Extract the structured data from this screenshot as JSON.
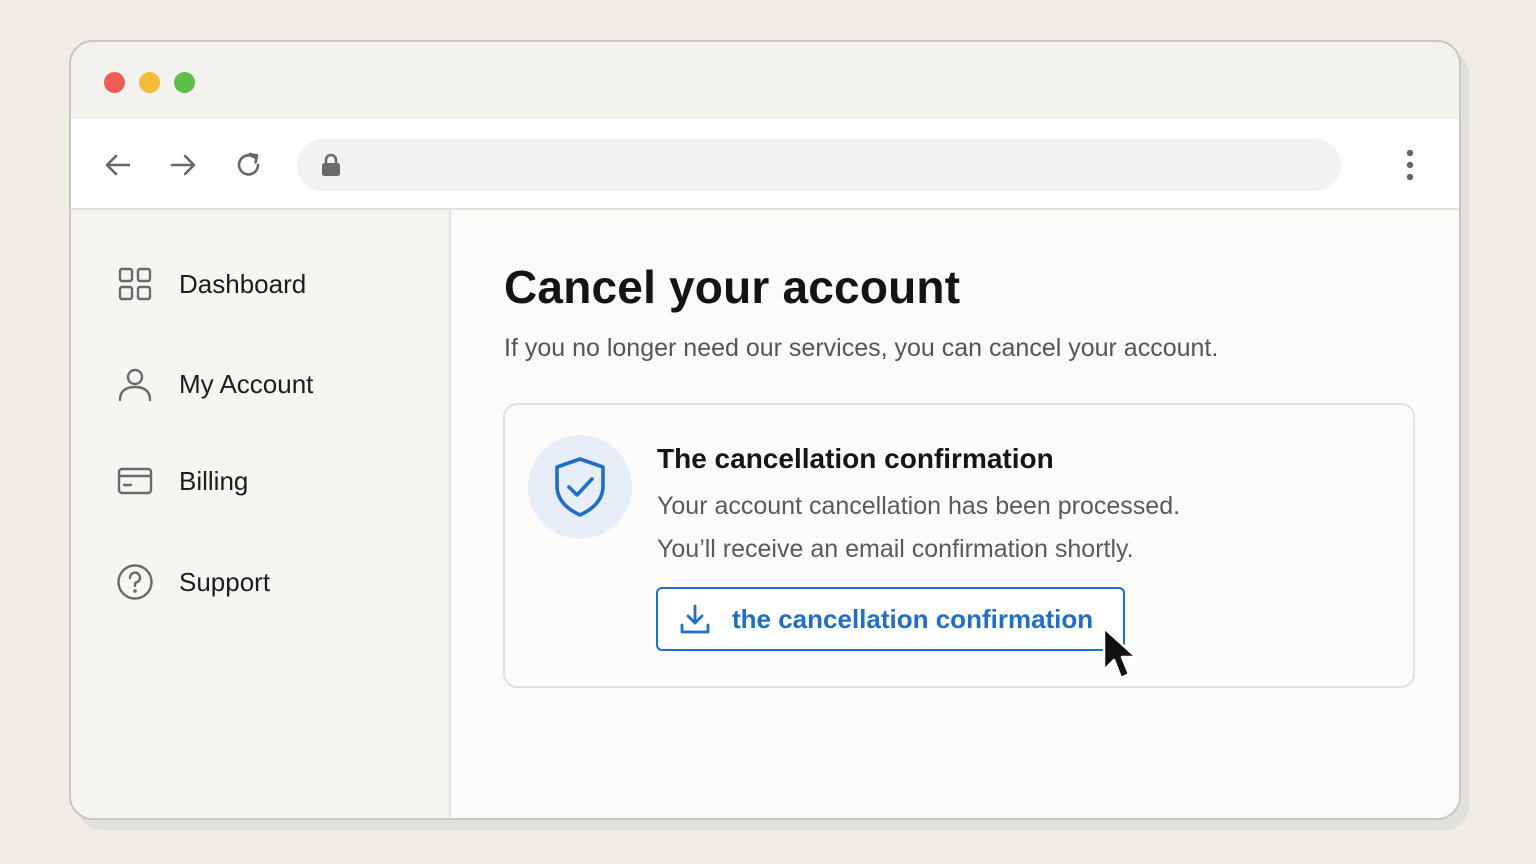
{
  "browser": {
    "url": "",
    "icons": {
      "back": "arrow-left-icon",
      "forward": "arrow-right-icon",
      "reload": "reload-icon",
      "lock": "lock-icon",
      "menu": "more-vertical-icon"
    },
    "traffic_lights": [
      "#ee5e55",
      "#f4bd35",
      "#5cbf47"
    ]
  },
  "sidebar": {
    "items": [
      {
        "label": "Dashboard",
        "icon": "grid-icon"
      },
      {
        "label": "My Account",
        "icon": "user-icon"
      },
      {
        "label": "Billing",
        "icon": "credit-card-icon"
      },
      {
        "label": "Support",
        "icon": "help-circle-icon"
      }
    ]
  },
  "main": {
    "title": "Cancel your account",
    "subtitle": "If you no longer need our services, you can cancel your account.",
    "card": {
      "icon": "shield-check-icon",
      "title": "The cancellation confirmation",
      "line1": "Your account cancellation has been processed.",
      "line2": "You’ll receive an email confirmation shortly.",
      "button_label": "the cancellation confirmation",
      "button_icon": "download-icon"
    }
  },
  "colors": {
    "accent": "#1f6fc8",
    "background": "#efede6"
  }
}
